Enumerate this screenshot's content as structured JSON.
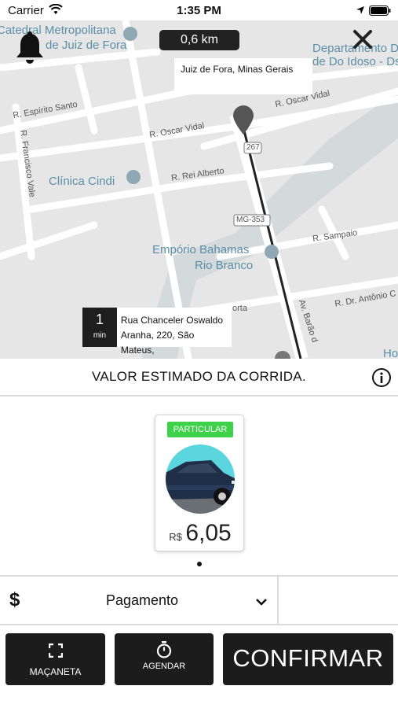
{
  "status_bar": {
    "carrier": "Carrier",
    "time": "1:35 PM"
  },
  "map": {
    "distance": "0,6 km",
    "destination": "Juiz de Fora, Minas Gerais",
    "origin_eta_value": "1",
    "origin_eta_unit": "min",
    "origin_address_line1": "Rua Chanceler Oswaldo",
    "origin_address_line2": "Aranha, 220, São Mateus,",
    "labels": {
      "catedral_line1": "Catedral Metropolitana",
      "catedral_line2": "de Juiz de Fora",
      "departamento_line1": "Departamento Do",
      "departamento_line2": "de Do Idoso - Ds",
      "clinica": "Clínica Cindi",
      "emporio_line1": "Empório Bahamas",
      "emporio_line2": "Rio Branco",
      "r_espirito_santo": "R. Espírito Santo",
      "r_francisco_vale": "R. Francisco Vale",
      "r_oscar_vidal_1": "R. Oscar Vidal",
      "r_oscar_vidal_2": "R. Oscar Vidal",
      "r_rei_alberto": "R. Rei Alberto",
      "r_sampaio": "R. Sampaio",
      "r_dr_antonio": "R. Dr. Antônio C",
      "av_barao": "Av. Barão d",
      "shield_267": "267",
      "shield_mg353": "MG-353",
      "porta": "orta",
      "ho": "Ho"
    }
  },
  "estimate": {
    "title": "VALOR ESTIMADO DA CORRIDA."
  },
  "vehicle": {
    "category": "PARTICULAR",
    "currency": "R$",
    "price": "6,05"
  },
  "payment": {
    "icon": "$",
    "label": "Pagamento"
  },
  "buttons": {
    "handle": "MAÇANETA",
    "schedule": "AGENDAR",
    "confirm": "CONFIRMAR"
  },
  "colors": {
    "badge": "#3ed24b",
    "button_bg": "#1c1c1c",
    "map_bg": "#e6e6e6",
    "poi": "#5a8fa8"
  }
}
